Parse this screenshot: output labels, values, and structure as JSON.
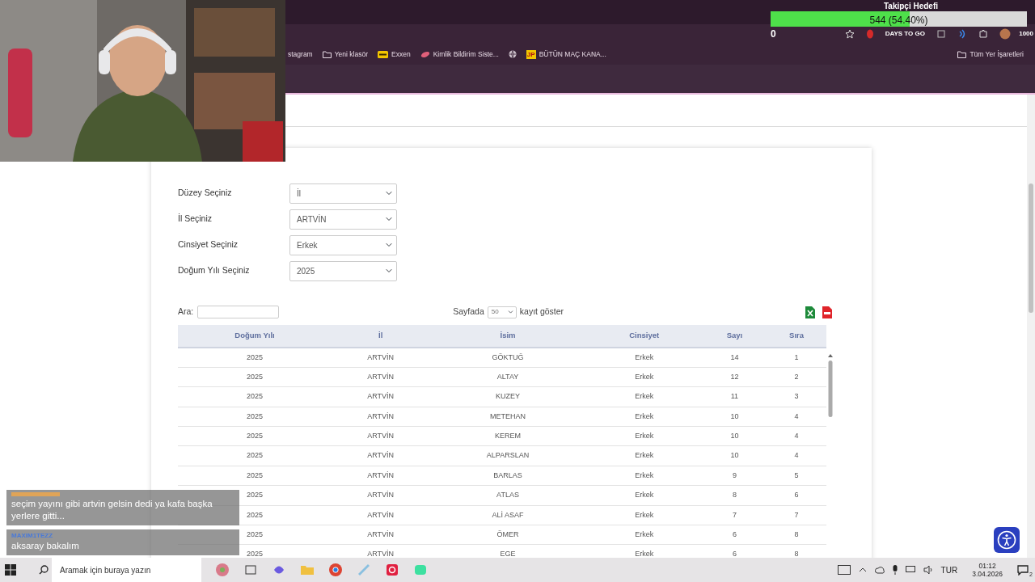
{
  "browser": {
    "bookmarks": [
      {
        "kind": "plain",
        "label": "stagram"
      },
      {
        "kind": "folder",
        "label": "Yeni klasör"
      },
      {
        "kind": "exxen",
        "label": "Exxen"
      },
      {
        "kind": "leaf",
        "label": "Kimlik Bildirim Siste..."
      },
      {
        "kind": "globe"
      },
      {
        "kind": "badge",
        "badge": "JP",
        "label": "BÜTÜN MAÇ KANA..."
      }
    ],
    "all_bookmarks": "Tüm Yer İşaretleri"
  },
  "follower_goal": {
    "title": "Takipçi Hedefi",
    "level": 0.544,
    "reading": "544 (54.40%)",
    "min": "0",
    "max": "1000",
    "countdown": "DAYS TO GO"
  },
  "form": {
    "fields": [
      {
        "label": "Düzey Seçiniz",
        "value": "İl"
      },
      {
        "label": "İl Seçiniz",
        "value": "ARTVİN"
      },
      {
        "label": "Cinsiyet Seçiniz",
        "value": "Erkek"
      },
      {
        "label": "Doğum Yılı Seçiniz",
        "value": "2025"
      }
    ]
  },
  "table_toolbar": {
    "search_label": "Ara:",
    "page_size_prefix": "Sayfada",
    "page_size": "50",
    "page_size_suffix": "kayıt göster"
  },
  "table": {
    "columns": [
      "Doğum Yılı",
      "İl",
      "İsim",
      "Cinsiyet",
      "Sayı",
      "Sıra"
    ],
    "rows": [
      [
        "2025",
        "ARTVİN",
        "GÖKTUĞ",
        "Erkek",
        "14",
        "1"
      ],
      [
        "2025",
        "ARTVİN",
        "ALTAY",
        "Erkek",
        "12",
        "2"
      ],
      [
        "2025",
        "ARTVİN",
        "KUZEY",
        "Erkek",
        "11",
        "3"
      ],
      [
        "2025",
        "ARTVİN",
        "METEHAN",
        "Erkek",
        "10",
        "4"
      ],
      [
        "2025",
        "ARTVİN",
        "KEREM",
        "Erkek",
        "10",
        "4"
      ],
      [
        "2025",
        "ARTVİN",
        "ALPARSLAN",
        "Erkek",
        "10",
        "4"
      ],
      [
        "2025",
        "ARTVİN",
        "BARLAS",
        "Erkek",
        "9",
        "5"
      ],
      [
        "2025",
        "ARTVİN",
        "ATLAS",
        "Erkek",
        "8",
        "6"
      ],
      [
        "2025",
        "ARTVİN",
        "ALİ ASAF",
        "Erkek",
        "7",
        "7"
      ],
      [
        "2025",
        "ARTVİN",
        "ÖMER",
        "Erkek",
        "6",
        "8"
      ],
      [
        "2025",
        "ARTVİN",
        "EGE",
        "Erkek",
        "6",
        "8"
      ]
    ]
  },
  "chat": [
    {
      "text": "seçim yayını gibi artvin gelsin dedi ya kafa başka yerlere gitti..."
    },
    {
      "user": "MAXIM1TEZZ",
      "text": "aksaray bakalım"
    }
  ],
  "taskbar": {
    "search_placeholder": "Aramak için buraya yazın",
    "language": "TUR",
    "time": "01:12",
    "date": "3.04.2026",
    "notifications": "2"
  }
}
